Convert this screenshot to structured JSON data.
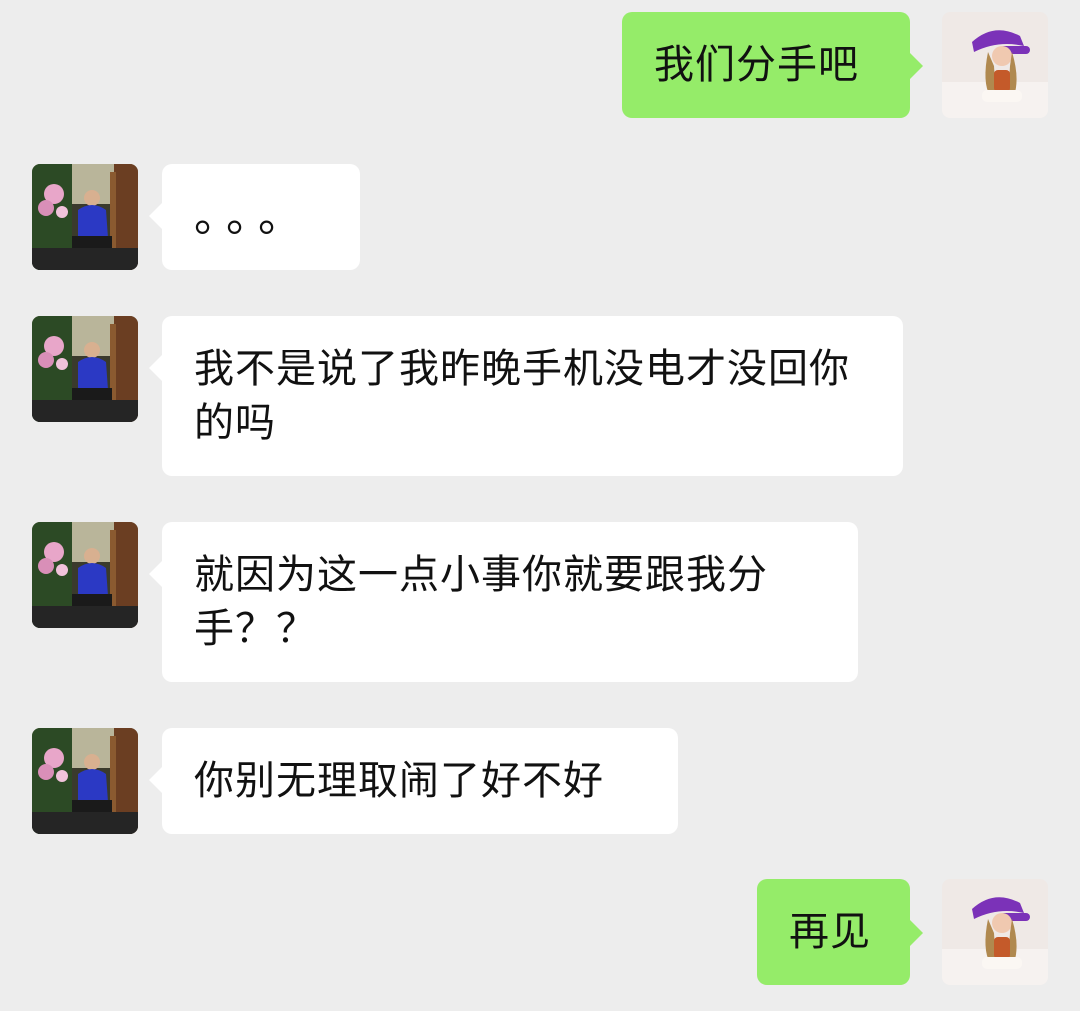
{
  "messages": [
    {
      "side": "outgoing",
      "text": "我们分手吧"
    },
    {
      "side": "incoming",
      "text": "。。。"
    },
    {
      "side": "incoming",
      "text": "我不是说了我昨晚手机没电才没回你的吗"
    },
    {
      "side": "incoming",
      "text": "就因为这一点小事你就要跟我分手？？"
    },
    {
      "side": "incoming",
      "text": "你别无理取闹了好不好"
    },
    {
      "side": "outgoing",
      "text": "再见"
    }
  ],
  "colors": {
    "background": "#ededed",
    "incoming_bubble": "#ffffff",
    "outgoing_bubble": "#95ec69",
    "text": "#111111"
  },
  "icons": {
    "self_avatar": "girl-purple-cap-avatar",
    "contact_avatar": "boy-garden-avatar"
  }
}
